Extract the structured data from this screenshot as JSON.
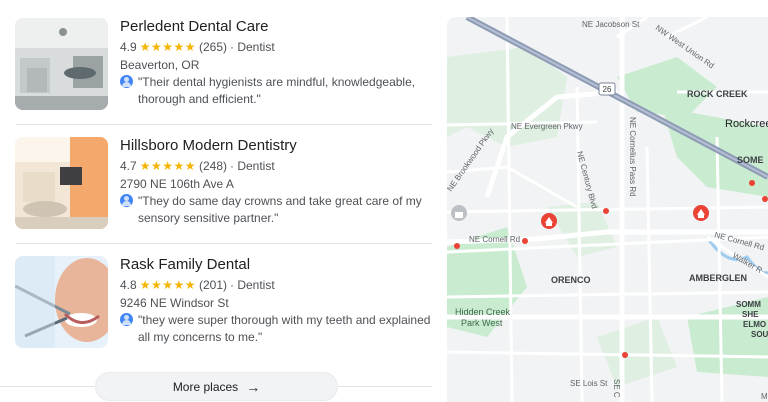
{
  "places": [
    {
      "name": "Perledent Dental Care",
      "rating": "4.9",
      "stars": "★★★★★",
      "count": "(265)",
      "category": "· Dentist",
      "address": "Beaverton, OR",
      "review": "\"Their dental hygienists are mindful, knowledgeable, thorough and efficient.\""
    },
    {
      "name": "Hillsboro Modern Dentistry",
      "rating": "4.7",
      "stars": "★★★★★",
      "count": "(248)",
      "category": "· Dentist",
      "address": "2790 NE 106th Ave A",
      "review": "\"They do same day crowns and take great care of my sensory sensitive partner.\""
    },
    {
      "name": "Rask Family Dental",
      "rating": "4.8",
      "stars": "★★★★★",
      "count": "(201)",
      "category": "· Dentist",
      "address": "9246 NE Windsor St",
      "review": "\"they were super thorough with my teeth and explained all my concerns to me.\""
    }
  ],
  "more_places": {
    "label": "More places",
    "arrow": "→"
  },
  "map": {
    "labels": {
      "jacobson": "NE Jacobson St",
      "west_union": "NW West Union Rd",
      "hwy": "26",
      "rock_creek": "ROCK CREEK",
      "rockcreek": "Rockcree",
      "evergreen": "NE Evergreen Pkwy",
      "cornelius_pass": "NE Cornelius Pass Rd",
      "brookwood": "NE Brookwood Pkwy",
      "century": "NE Century Blvd",
      "some": "SOME",
      "cornell_rd_e": "NE Cornell Rd",
      "cornell_rd_w": "NE Cornell Rd",
      "walker": "Walker R",
      "orenco": "ORENCO",
      "amberglen": "AMBERGLEN",
      "hidden_creek": "Hidden Creek",
      "park_west": "Park West",
      "somm": "SOMM",
      "she": "SHE",
      "elmo": "ELMO",
      "sou": "SOU",
      "lois": "SE Lois St",
      "se_c": "SE C",
      "m": "M"
    },
    "colors": {
      "land": "#f1f3f4",
      "green": "#c9ebd0",
      "road": "#ffffff",
      "highway": "#8e9bb5",
      "water": "#9ecbf0",
      "pin": "#ea4335"
    }
  }
}
